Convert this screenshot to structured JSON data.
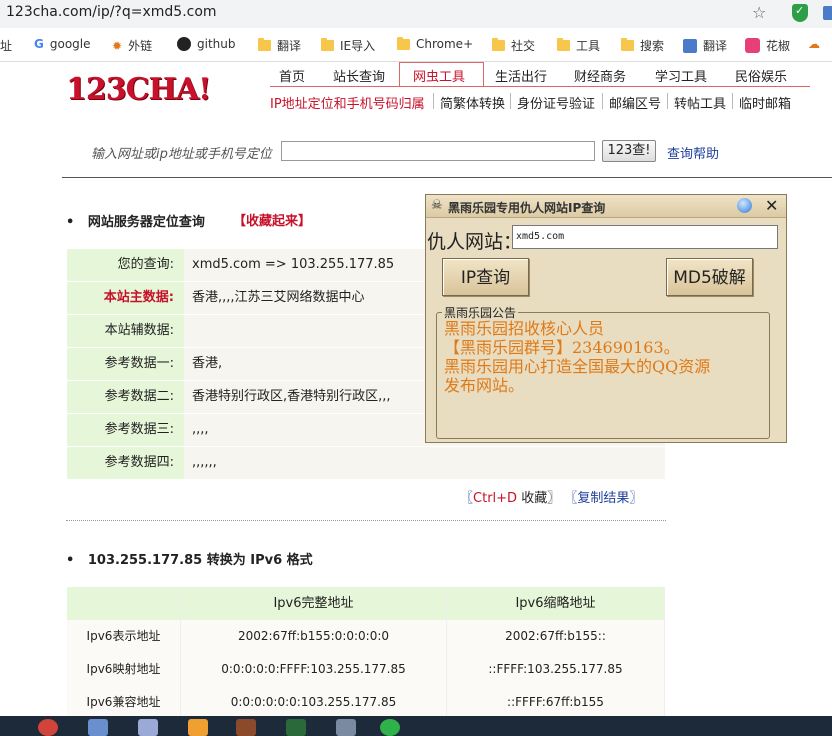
{
  "browser": {
    "url": "123cha.com/ip/?q=xmd5.com",
    "bookmarks": [
      {
        "label": "址",
        "icon": "none"
      },
      {
        "label": "google",
        "icon": "google-icon"
      },
      {
        "label": "外链",
        "icon": "gear-icon"
      },
      {
        "label": "github",
        "icon": "github-icon"
      },
      {
        "label": "翻译",
        "icon": "folder-icon"
      },
      {
        "label": "IE导入",
        "icon": "folder-icon"
      },
      {
        "label": "Chrome+",
        "icon": "folder-icon"
      },
      {
        "label": "社交",
        "icon": "folder-icon"
      },
      {
        "label": "工具",
        "icon": "folder-icon"
      },
      {
        "label": "搜索",
        "icon": "folder-icon"
      },
      {
        "label": "翻译",
        "icon": "translate-icon"
      },
      {
        "label": "花椒",
        "icon": "huajiao-icon"
      }
    ]
  },
  "site": {
    "logo": "123CHA!",
    "nav_primary": [
      "首页",
      "站长查询",
      "网虫工具",
      "生活出行",
      "财经商务",
      "学习工具",
      "民俗娱乐"
    ],
    "nav_primary_active": "网虫工具",
    "nav_secondary": [
      "IP地址定位和手机号码归属",
      "简繁体转换",
      "身份证号验证",
      "邮编区号",
      "转帖工具",
      "临时邮箱"
    ],
    "search": {
      "label": "输入网址或ip地址或手机号定位",
      "value": "",
      "button": "123查!",
      "help": "查询帮助"
    }
  },
  "result": {
    "section_title": "网站服务器定位查询",
    "favorite": "【收藏起来】",
    "rows": [
      {
        "label": "您的查询:",
        "value": "xmd5.com => 103.255.177.85",
        "highlight": false
      },
      {
        "label": "本站主数据:",
        "value": "香港,,,,江苏三艾网络数据中心",
        "highlight": true
      },
      {
        "label": "本站辅数据:",
        "value": "",
        "highlight": false
      },
      {
        "label": "参考数据一:",
        "value": "香港,",
        "highlight": false
      },
      {
        "label": "参考数据二:",
        "value": "香港特别行政区,香港特别行政区,,,",
        "highlight": false
      },
      {
        "label": "参考数据三:",
        "value": ",,,,",
        "highlight": false
      },
      {
        "label": "参考数据四:",
        "value": ",,,,,,",
        "highlight": false
      }
    ],
    "links": {
      "open1": "〖",
      "key": "Ctrl+D",
      "fav": " 收藏〗",
      "open2": " 〖",
      "copy": "复制结果",
      "close2": "〗"
    }
  },
  "ipv6": {
    "section_title": "103.255.177.85 转换为 IPv6 格式",
    "headers": [
      "",
      "Ipv6完整地址",
      "Ipv6缩略地址"
    ],
    "rows": [
      {
        "label": "Ipv6表示地址",
        "full": "2002:67ff:b155:0:0:0:0:0",
        "short": "2002:67ff:b155::"
      },
      {
        "label": "Ipv6映射地址",
        "full": "0:0:0:0:0:FFFF:103.255.177.85",
        "short": "::FFFF:103.255.177.85"
      },
      {
        "label": "Ipv6兼容地址",
        "full": "0:0:0:0:0:0:103.255.177.85",
        "short": "::FFFF:67ff:b155"
      }
    ]
  },
  "popup": {
    "title": "黑雨乐园专用仇人网站IP查询",
    "label": "仇人网站：",
    "input_value": "xmd5.com",
    "btn_ip": "IP查询",
    "btn_md5": "MD5破解",
    "notice_title": "黑雨乐园公告",
    "notice_lines": [
      "黑雨乐园招收核心人员",
      "【黑雨乐园群号】234690163。",
      "黑雨乐园用心打造全国最大的QQ资源",
      "发布网站。"
    ]
  },
  "colors": {
    "accent_red": "#c8112a",
    "link_blue": "#1f3f9a",
    "label_green": "#e6f6d8",
    "popup_bg": "#e8dcc1",
    "notice_orange": "#e07a16"
  }
}
